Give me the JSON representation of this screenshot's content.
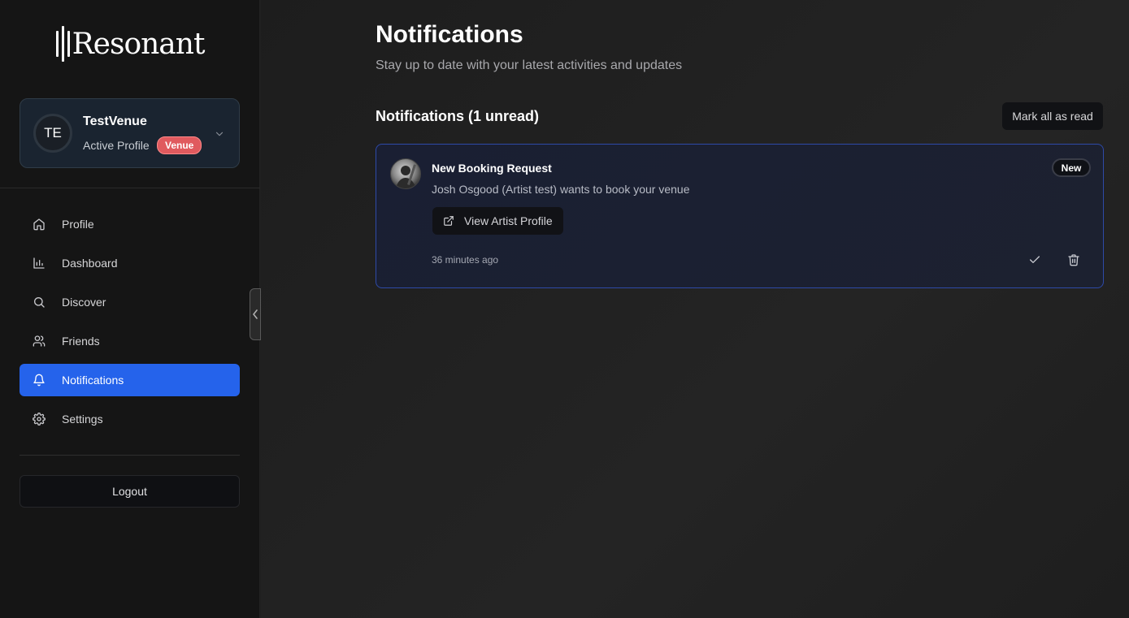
{
  "app": {
    "logo_text": "Resonant"
  },
  "profile": {
    "initials": "TE",
    "name": "TestVenue",
    "subtitle": "Active Profile",
    "badge": "Venue"
  },
  "sidebar": {
    "items": [
      {
        "label": "Profile",
        "icon": "home-icon",
        "active": false
      },
      {
        "label": "Dashboard",
        "icon": "bar-chart-icon",
        "active": false
      },
      {
        "label": "Discover",
        "icon": "search-icon",
        "active": false
      },
      {
        "label": "Friends",
        "icon": "users-icon",
        "active": false
      },
      {
        "label": "Notifications",
        "icon": "bell-icon",
        "active": true
      },
      {
        "label": "Settings",
        "icon": "gear-icon",
        "active": false
      }
    ],
    "logout_label": "Logout"
  },
  "main": {
    "title": "Notifications",
    "subtitle": "Stay up to date with your latest activities and updates",
    "section_title": "Notifications (1 unread)",
    "mark_all_label": "Mark all as read",
    "notifications": [
      {
        "title": "New Booking Request",
        "badge": "New",
        "message": "Josh Osgood (Artist test) wants to book your venue",
        "action_label": "View Artist Profile",
        "time": "36 minutes ago"
      }
    ]
  },
  "colors": {
    "accent": "#2563eb",
    "venue_badge": "#e05a5e",
    "card_border": "#2e4aa8"
  }
}
